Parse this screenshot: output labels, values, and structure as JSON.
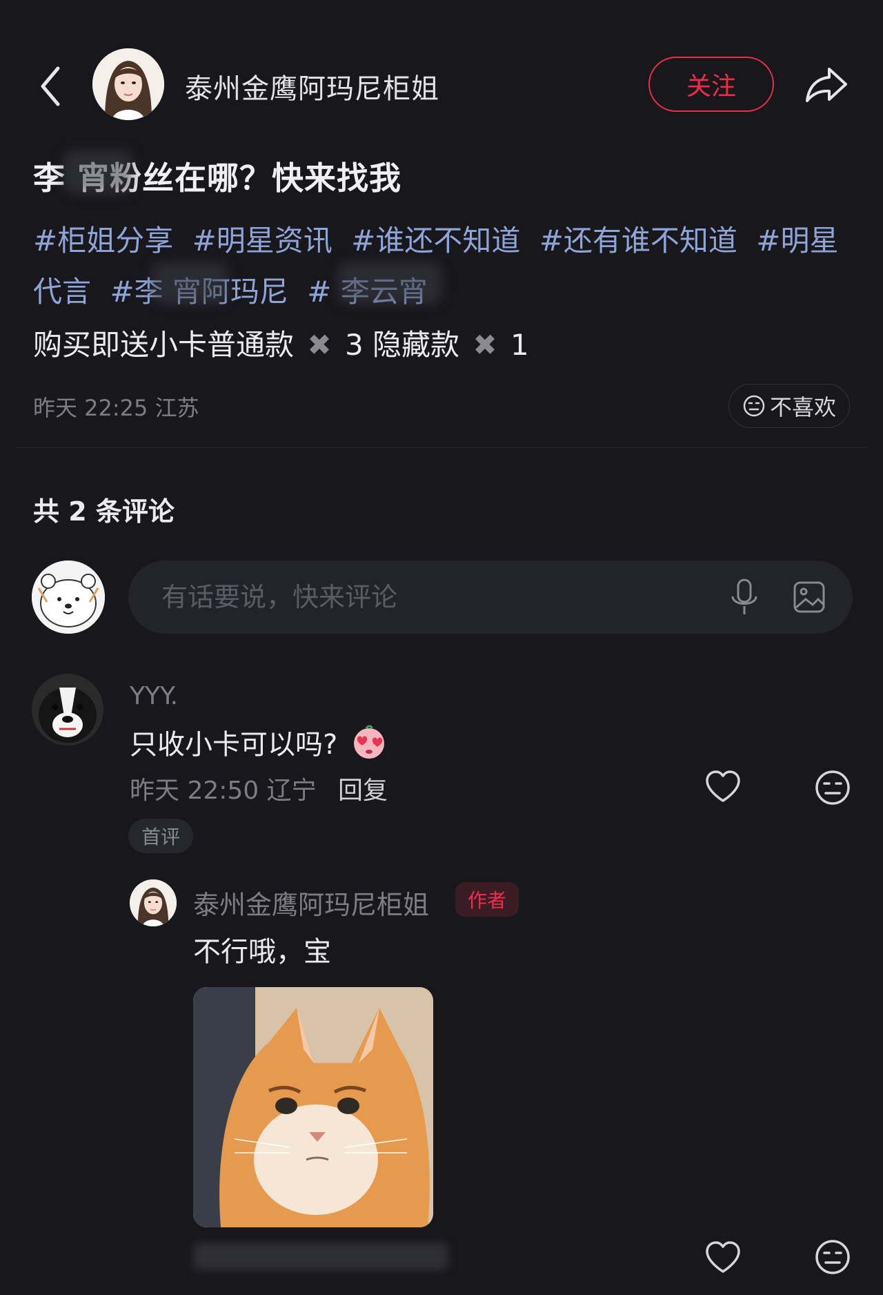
{
  "header": {
    "back_icon": "chevron-left-icon",
    "author_name": "泰州金鹰阿玛尼柜姐",
    "follow_label": "关注",
    "share_icon": "share-arrow-icon"
  },
  "post": {
    "title": "李 宵粉丝在哪？快来找我",
    "tags": [
      "#柜姐分享",
      "#明星资讯",
      "#谁还不知道",
      "#还有谁不知道",
      "#明星代言",
      "#李 宵阿玛尼",
      "# 李云宵"
    ],
    "body_prefix": "购买即送小卡普通款",
    "body_x1": "✖",
    "body_mid": "3 隐藏款",
    "body_x2": "✖",
    "body_suffix": "1",
    "meta": "昨天 22:25 江苏",
    "dislike_label": "不喜欢"
  },
  "comments": {
    "count_label": "共 2 条评论",
    "input_placeholder": "有话要说，快来评论",
    "items": [
      {
        "user": "YYY.",
        "text": "只收小卡可以吗?",
        "meta": "昨天 22:50 辽宁",
        "reply_label": "回复",
        "badge": "首评"
      },
      {
        "user": "泰州金鹰阿玛尼柜姐",
        "author_badge": "作者",
        "text": "不行哦，宝"
      }
    ]
  },
  "colors": {
    "background": "#17171c",
    "accent_red": "#ef2d4a",
    "tag_blue": "#8fa5d8",
    "muted_text": "#7d7d86"
  }
}
